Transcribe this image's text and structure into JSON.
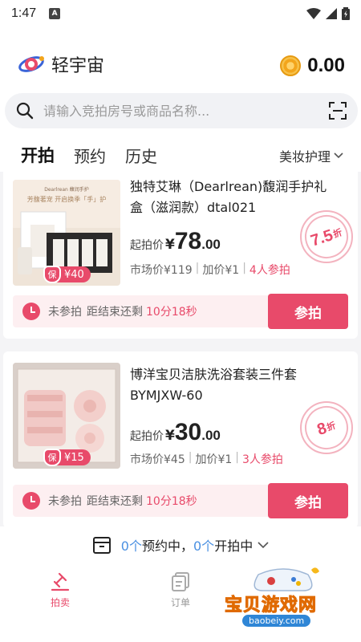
{
  "status_bar": {
    "time": "1:47",
    "notification_glyph": "A"
  },
  "header": {
    "app_name": "轻宇宙",
    "coin_balance": "0.00",
    "search_placeholder": "请输入竞拍房号或商品名称..."
  },
  "tabs": [
    {
      "label": "开拍",
      "active": true
    },
    {
      "label": "预约",
      "active": false
    },
    {
      "label": "历史",
      "active": false
    }
  ],
  "category": "美妆护理",
  "items": [
    {
      "title": "独特艾琳（Dearlrean)馥润手护礼盒（滋润款）dtal021",
      "deposit": "¥40",
      "deposit_badge": "保",
      "price_label": "起拍价",
      "currency": "¥",
      "price_int": "78",
      "price_dec": ".00",
      "market_price": "市场价¥119",
      "increment": "加价¥1",
      "participants": "4人参拍",
      "discount_num": "7.5",
      "discount_unit": "折",
      "status": "未参拍",
      "remain_label": "距结束还剩",
      "countdown": "10分18秒",
      "action": "参拍"
    },
    {
      "title": "博洋宝贝洁肤洗浴套装三件套BYMJXW-60",
      "deposit": "¥15",
      "deposit_badge": "保",
      "price_label": "起拍价",
      "currency": "¥",
      "price_int": "30",
      "price_dec": ".00",
      "market_price": "市场价¥45",
      "increment": "加价¥1",
      "participants": "3人参拍",
      "discount_num": "8",
      "discount_unit": "折",
      "status": "未参拍",
      "remain_label": "距结束还剩",
      "countdown": "10分18秒",
      "action": "参拍"
    }
  ],
  "summary": {
    "reserved_count": "0个",
    "reserved_label": "预约中，",
    "live_count": "0个",
    "live_label": "开拍中"
  },
  "bottom_nav": [
    {
      "label": "拍卖",
      "active": true
    },
    {
      "label": "订单",
      "active": false
    }
  ],
  "watermark": {
    "text": "宝贝游戏网",
    "url": "baobeiy.com"
  },
  "colors": {
    "accent": "#e84a6a",
    "link": "#4a90e2",
    "coin": "#f3a51b"
  }
}
